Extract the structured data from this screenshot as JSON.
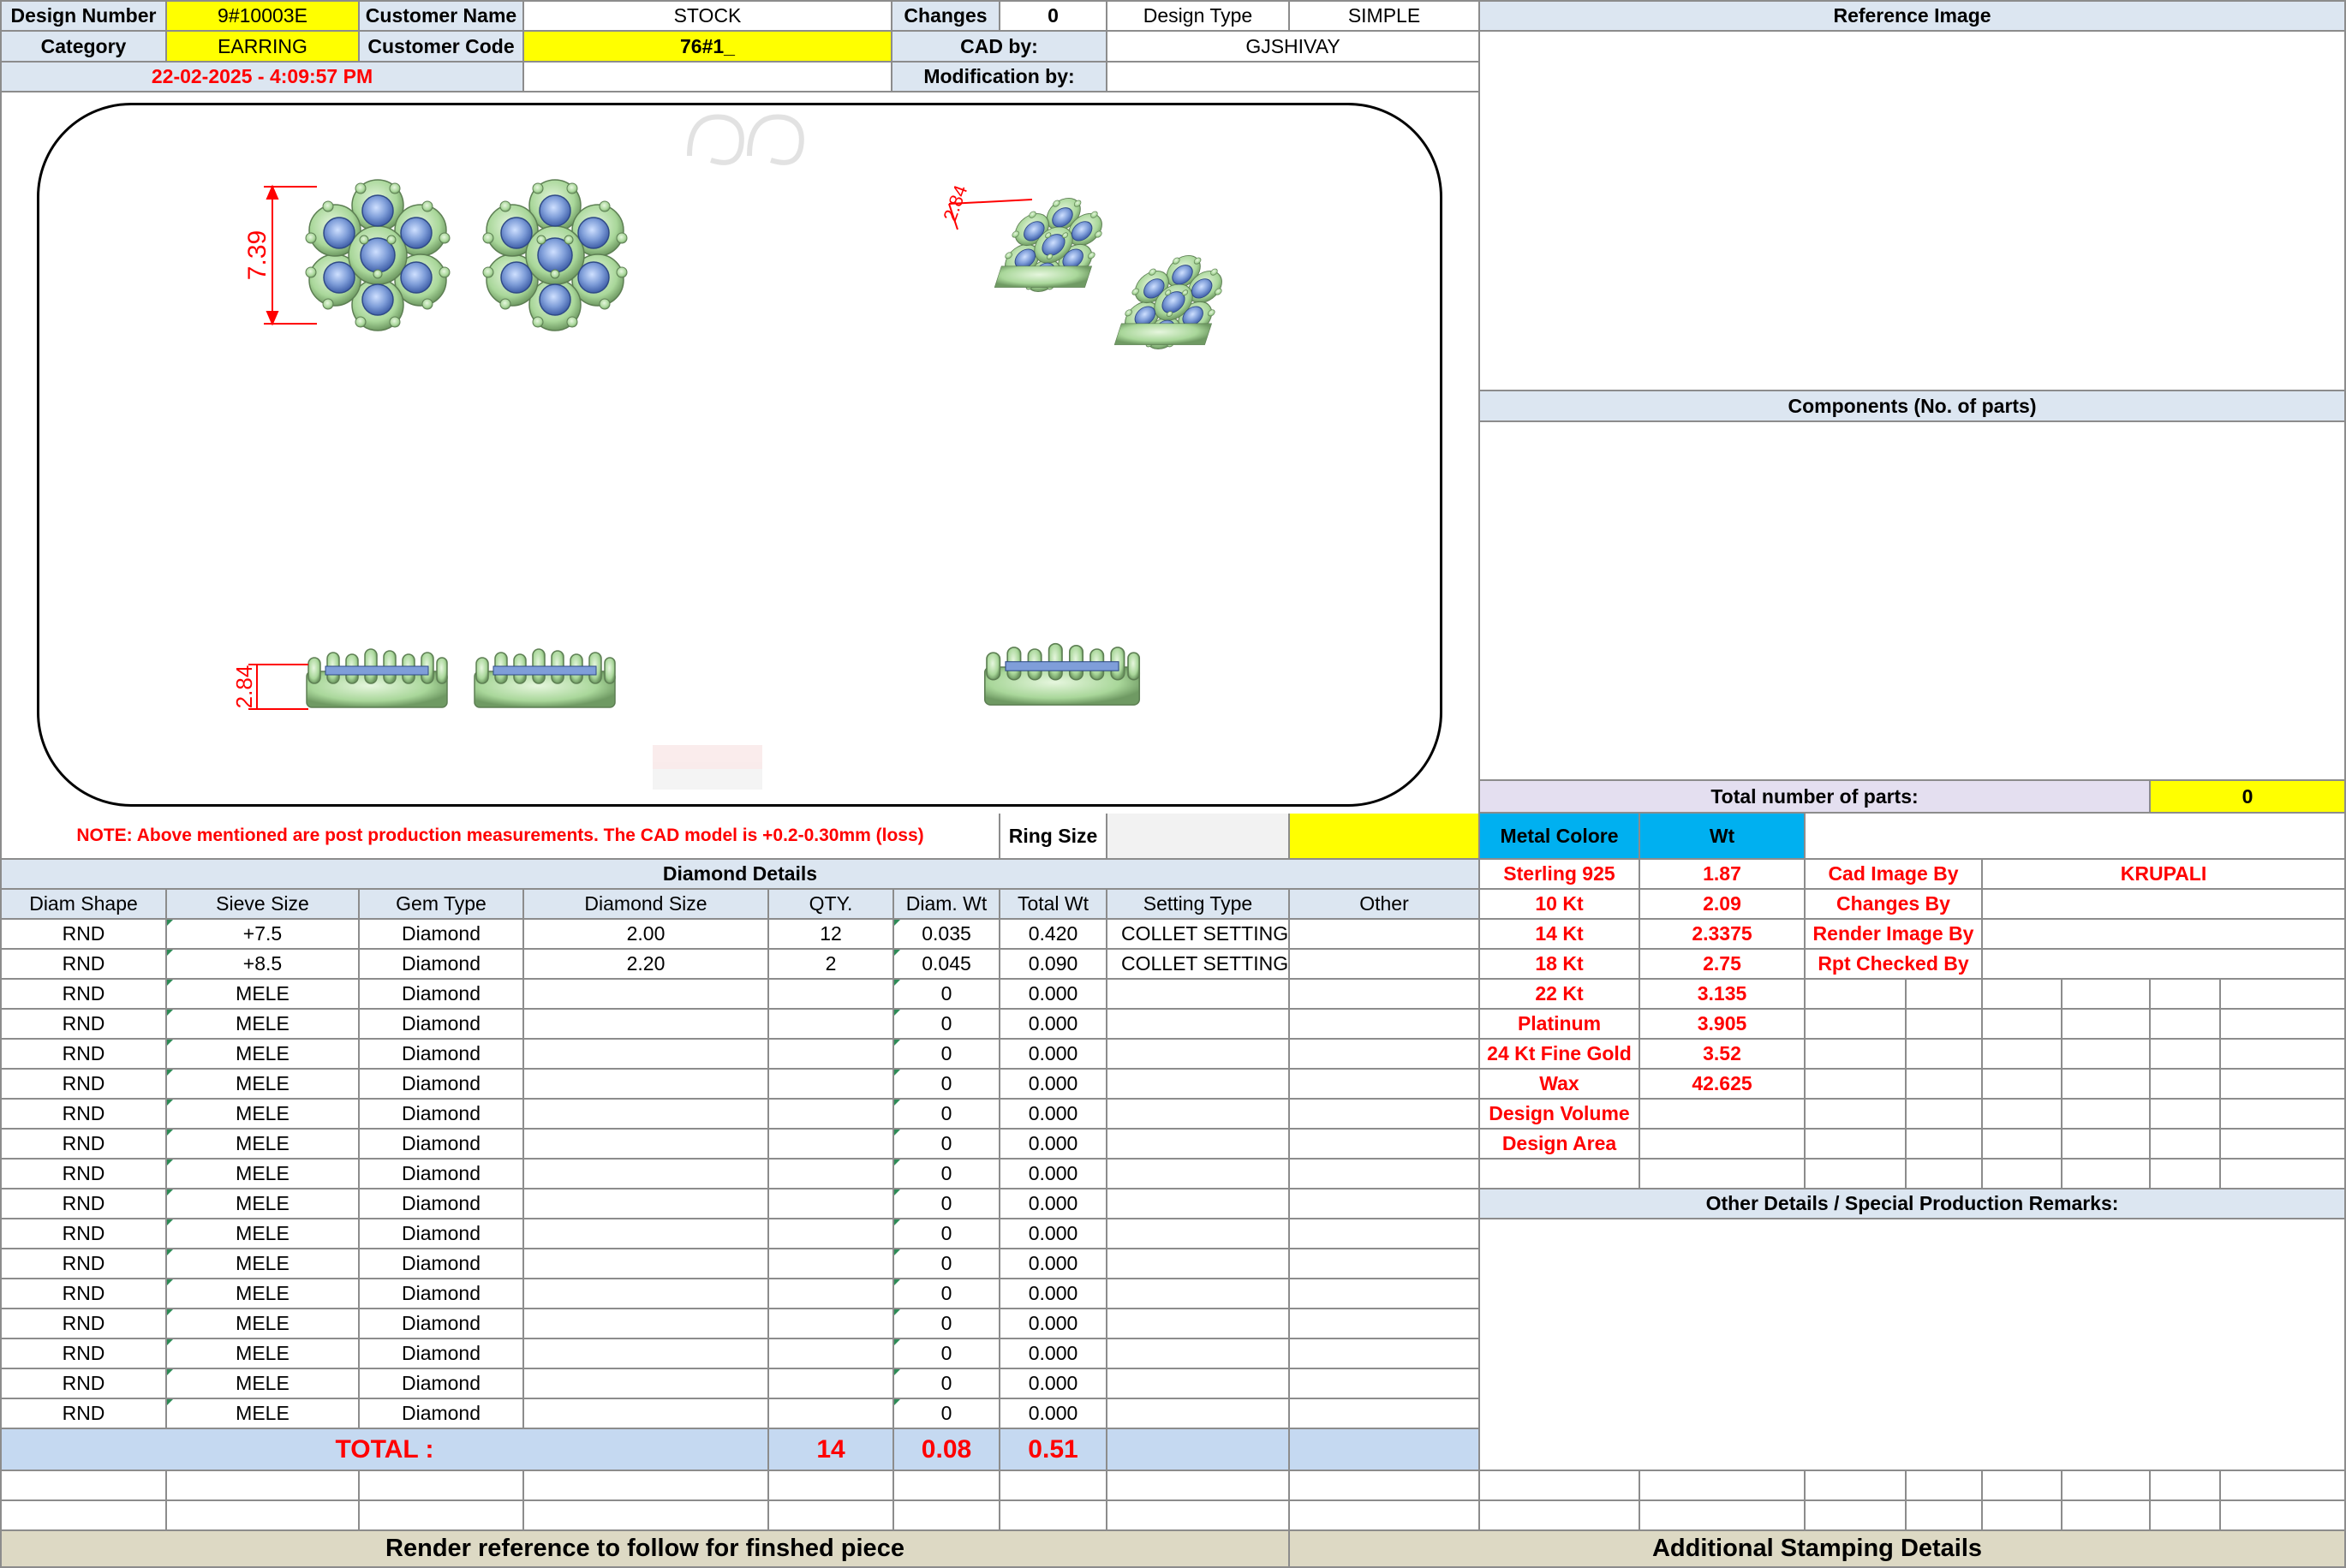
{
  "header": {
    "design_number_label": "Design Number",
    "design_number": "9#10003E",
    "customer_name_label": "Customer Name",
    "customer_name": "STOCK",
    "changes_label": "Changes",
    "changes": "0",
    "design_type_label": "Design Type",
    "design_type": "SIMPLE",
    "category_label": "Category",
    "category": "EARRING",
    "customer_code_label": "Customer Code",
    "customer_code": "76#1_",
    "cad_by_label": "CAD by:",
    "cad_by": "GJSHIVAY",
    "timestamp": "22-02-2025 - 4:09:57 PM",
    "modification_by_label": "Modification by:",
    "modification_by": ""
  },
  "cad_view": {
    "dim_top_height": "7.39",
    "dim_iso": "2.84",
    "dim_side_height": "2.84"
  },
  "right_panel": {
    "reference_image_title": "Reference Image",
    "components_title": "Components (No. of parts)",
    "total_parts_label": "Total number of parts:",
    "total_parts": "0"
  },
  "note": {
    "text": "NOTE: Above mentioned are post production measurements. The CAD model is +0.2-0.30mm (loss)",
    "ring_size_label": "Ring Size",
    "ring_size": ""
  },
  "metal": {
    "metal_colore_label": "Metal Colore",
    "wt_label": "Wt",
    "rows": [
      {
        "name": "Sterling 925",
        "wt": "1.87"
      },
      {
        "name": "10 Kt",
        "wt": "2.09"
      },
      {
        "name": "14 Kt",
        "wt": "2.3375"
      },
      {
        "name": "18 Kt",
        "wt": "2.75"
      },
      {
        "name": "22 Kt",
        "wt": "3.135"
      },
      {
        "name": "Platinum",
        "wt": "3.905"
      },
      {
        "name": "24 Kt Fine Gold",
        "wt": "3.52"
      },
      {
        "name": "Wax",
        "wt": "42.625"
      },
      {
        "name": "Design Volume",
        "wt": ""
      },
      {
        "name": "Design Area",
        "wt": ""
      }
    ]
  },
  "credits": {
    "cad_image_by_label": "Cad Image By",
    "cad_image_by": "KRUPALI",
    "changes_by_label": "Changes By",
    "changes_by": "",
    "render_image_by_label": "Render Image By",
    "render_image_by": "",
    "rpt_checked_by_label": "Rpt Checked By",
    "rpt_checked_by": ""
  },
  "diamond": {
    "title": "Diamond Details",
    "columns": [
      "Diam Shape",
      "Sieve Size",
      "Gem Type",
      "Diamond Size",
      "QTY.",
      "Diam. Wt",
      "Total Wt",
      "Setting Type",
      "Other"
    ],
    "rows": [
      [
        "RND",
        "+7.5",
        "Diamond",
        "2.00",
        "12",
        "0.035",
        "0.420",
        "COLLET SETTING",
        ""
      ],
      [
        "RND",
        "+8.5",
        "Diamond",
        "2.20",
        "2",
        "0.045",
        "0.090",
        "COLLET SETTING",
        ""
      ],
      [
        "RND",
        "MELE",
        "Diamond",
        "",
        "",
        "0",
        "0.000",
        "",
        ""
      ],
      [
        "RND",
        "MELE",
        "Diamond",
        "",
        "",
        "0",
        "0.000",
        "",
        ""
      ],
      [
        "RND",
        "MELE",
        "Diamond",
        "",
        "",
        "0",
        "0.000",
        "",
        ""
      ],
      [
        "RND",
        "MELE",
        "Diamond",
        "",
        "",
        "0",
        "0.000",
        "",
        ""
      ],
      [
        "RND",
        "MELE",
        "Diamond",
        "",
        "",
        "0",
        "0.000",
        "",
        ""
      ],
      [
        "RND",
        "MELE",
        "Diamond",
        "",
        "",
        "0",
        "0.000",
        "",
        ""
      ],
      [
        "RND",
        "MELE",
        "Diamond",
        "",
        "",
        "0",
        "0.000",
        "",
        ""
      ],
      [
        "RND",
        "MELE",
        "Diamond",
        "",
        "",
        "0",
        "0.000",
        "",
        ""
      ],
      [
        "RND",
        "MELE",
        "Diamond",
        "",
        "",
        "0",
        "0.000",
        "",
        ""
      ],
      [
        "RND",
        "MELE",
        "Diamond",
        "",
        "",
        "0",
        "0.000",
        "",
        ""
      ],
      [
        "RND",
        "MELE",
        "Diamond",
        "",
        "",
        "0",
        "0.000",
        "",
        ""
      ],
      [
        "RND",
        "MELE",
        "Diamond",
        "",
        "",
        "0",
        "0.000",
        "",
        ""
      ],
      [
        "RND",
        "MELE",
        "Diamond",
        "",
        "",
        "0",
        "0.000",
        "",
        ""
      ],
      [
        "RND",
        "MELE",
        "Diamond",
        "",
        "",
        "0",
        "0.000",
        "",
        ""
      ],
      [
        "RND",
        "MELE",
        "Diamond",
        "",
        "",
        "0",
        "0.000",
        "",
        ""
      ]
    ],
    "total_label": "TOTAL :",
    "total_qty": "14",
    "total_diam_wt": "0.08",
    "total_wt": "0.51"
  },
  "other_details_title": "Other Details / Special Production Remarks:",
  "footer": {
    "render_reference": "Render reference to follow for finshed piece",
    "additional_stamping": "Additional Stamping Details"
  },
  "colors": {
    "header_blue": "#dce6f1",
    "yellow": "#ffff00",
    "red_text": "#ff0000",
    "metal_cyan": "#00b0f0",
    "total_row": "#c5d9f1",
    "footer_tan": "#ddd9c4",
    "metal_green": "#b5e0a8",
    "gem_blue": "#7f9ed9"
  }
}
